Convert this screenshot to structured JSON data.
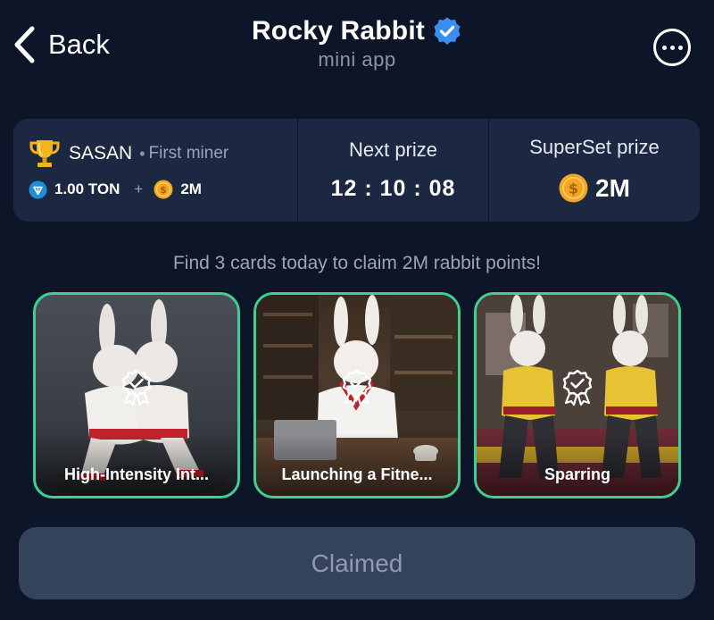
{
  "header": {
    "back_label": "Back",
    "title": "Rocky Rabbit",
    "subtitle": "mini app"
  },
  "stats": {
    "miner_name": "SASAN",
    "miner_separator": "•",
    "miner_role": "First miner",
    "reward_ton": "1.00 TON",
    "reward_plus": "+",
    "reward_coins": "2M",
    "next_prize_label": "Next prize",
    "next_prize_timer": "12 : 10 : 08",
    "superset_label": "SuperSet prize",
    "superset_value": "2M"
  },
  "hint": "Find 3 cards today to claim 2M rabbit points!",
  "cards": [
    {
      "title": "High-Intensity Int...",
      "icon": "award-check-icon"
    },
    {
      "title": "Launching a Fitne...",
      "icon": "award-check-icon"
    },
    {
      "title": "Sparring",
      "icon": "award-check-icon"
    }
  ],
  "claim_button": {
    "label": "Claimed"
  },
  "colors": {
    "background": "#0d1628",
    "panel": "#1c2841",
    "card_border": "#3fcf95",
    "button_bg": "#36445b",
    "button_text": "#8f9ab0",
    "verified": "#3a8ef0",
    "coin": "#f5a623"
  }
}
